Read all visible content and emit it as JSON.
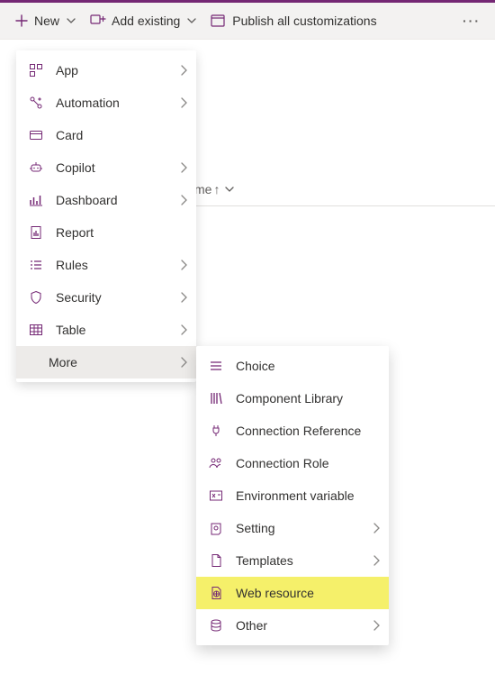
{
  "toolbar": {
    "new_label": "New",
    "add_existing_label": "Add existing",
    "publish_label": "Publish all customizations"
  },
  "column": {
    "header_fragment": "me",
    "sort_indicator": "↑"
  },
  "menu1": {
    "items": [
      {
        "label": "App"
      },
      {
        "label": "Automation"
      },
      {
        "label": "Card"
      },
      {
        "label": "Copilot"
      },
      {
        "label": "Dashboard"
      },
      {
        "label": "Report"
      },
      {
        "label": "Rules"
      },
      {
        "label": "Security"
      },
      {
        "label": "Table"
      },
      {
        "label": "More"
      }
    ]
  },
  "menu2": {
    "items": [
      {
        "label": "Choice"
      },
      {
        "label": "Component Library"
      },
      {
        "label": "Connection Reference"
      },
      {
        "label": "Connection Role"
      },
      {
        "label": "Environment variable"
      },
      {
        "label": "Setting"
      },
      {
        "label": "Templates"
      },
      {
        "label": "Web resource"
      },
      {
        "label": "Other"
      }
    ]
  }
}
